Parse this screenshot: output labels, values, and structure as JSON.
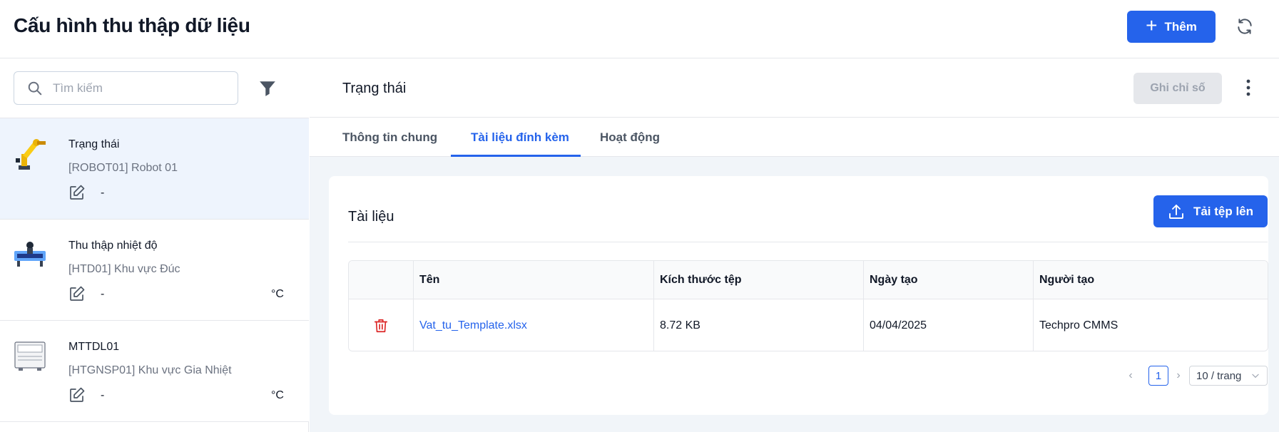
{
  "header": {
    "title": "Cấu hình thu thập dữ liệu",
    "add_button": "Thêm"
  },
  "sidebar": {
    "search_placeholder": "Tìm kiếm",
    "items": [
      {
        "title": "Trạng thái",
        "subtitle": "[ROBOT01] Robot 01",
        "value": "-",
        "unit": "",
        "active": true
      },
      {
        "title": "Thu thập nhiệt độ",
        "subtitle": "[HTD01] Khu vực Đúc",
        "value": "-",
        "unit": "°C"
      },
      {
        "title": "MTTDL01",
        "subtitle": "[HTGNSP01] Khu vực Gia Nhiệt",
        "value": "-",
        "unit": "°C"
      }
    ]
  },
  "detail": {
    "title": "Trạng thái",
    "record_button": "Ghi chỉ số",
    "tabs": [
      {
        "label": "Thông tin chung"
      },
      {
        "label": "Tài liệu đính kèm",
        "active": true
      },
      {
        "label": "Hoạt động"
      }
    ]
  },
  "documents": {
    "title": "Tài liệu",
    "upload_button": "Tải tệp lên",
    "columns": [
      "Tên",
      "Kích thước tệp",
      "Ngày tạo",
      "Người tạo"
    ],
    "rows": [
      {
        "name": "Vat_tu_Template.xlsx",
        "size": "8.72 KB",
        "created": "04/04/2025",
        "creator": "Techpro CMMS"
      }
    ],
    "pagination": {
      "current_page": "1",
      "page_size": "10 / trang"
    }
  },
  "colors": {
    "primary": "#2563eb",
    "danger": "#dc2626",
    "active_bg": "#eef4fd"
  }
}
